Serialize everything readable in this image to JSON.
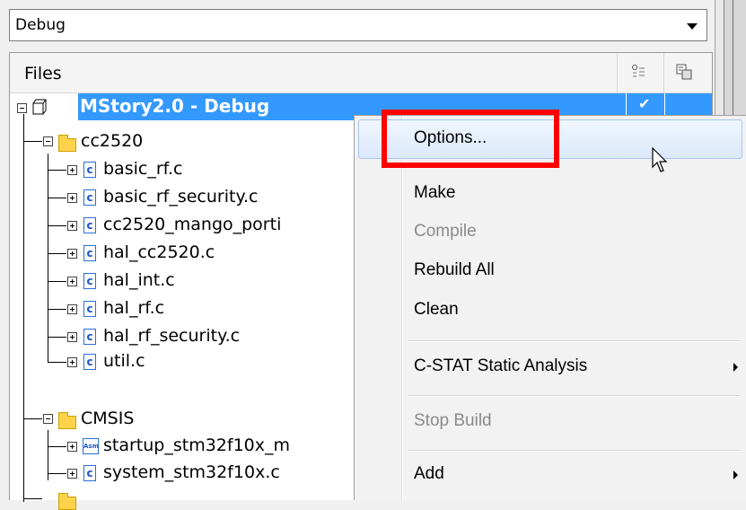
{
  "config_dropdown": {
    "value": "Debug"
  },
  "files_panel": {
    "header_title": "Files",
    "header_icons": [
      "build-status-icon",
      "options-icon"
    ],
    "project": {
      "label": "MStory2.0 - Debug",
      "checked": "✔"
    },
    "tree": [
      {
        "label": "cc2520",
        "kind": "folder"
      },
      {
        "label": "basic_rf.c",
        "kind": "c"
      },
      {
        "label": "basic_rf_security.c",
        "kind": "c"
      },
      {
        "label": "cc2520_mango_porti",
        "kind": "c"
      },
      {
        "label": "hal_cc2520.c",
        "kind": "c"
      },
      {
        "label": "hal_int.c",
        "kind": "c"
      },
      {
        "label": "hal_rf.c",
        "kind": "c"
      },
      {
        "label": "hal_rf_security.c",
        "kind": "c"
      },
      {
        "label": "util.c",
        "kind": "c"
      },
      {
        "label": "CMSIS",
        "kind": "folder"
      },
      {
        "label": "startup_stm32f10x_m",
        "kind": "asm"
      },
      {
        "label": "system_stm32f10x.c",
        "kind": "c"
      }
    ],
    "c_icon_text": "c",
    "asm_icon_text": "Asm"
  },
  "context_menu": {
    "items": [
      {
        "label": "Options...",
        "enabled": true,
        "highlighted": true
      },
      {
        "label": "Make",
        "enabled": true
      },
      {
        "label": "Compile",
        "enabled": false
      },
      {
        "label": "Rebuild All",
        "enabled": true
      },
      {
        "label": "Clean",
        "enabled": true
      },
      {
        "label": "C-STAT Static Analysis",
        "enabled": true,
        "submenu": true
      },
      {
        "label": "Stop Build",
        "enabled": false
      },
      {
        "label": "Add",
        "enabled": true,
        "submenu": true
      }
    ]
  },
  "colors": {
    "selection": "#3399ff",
    "highlight_box": "#ff0000",
    "folder": "#ffd24a"
  }
}
